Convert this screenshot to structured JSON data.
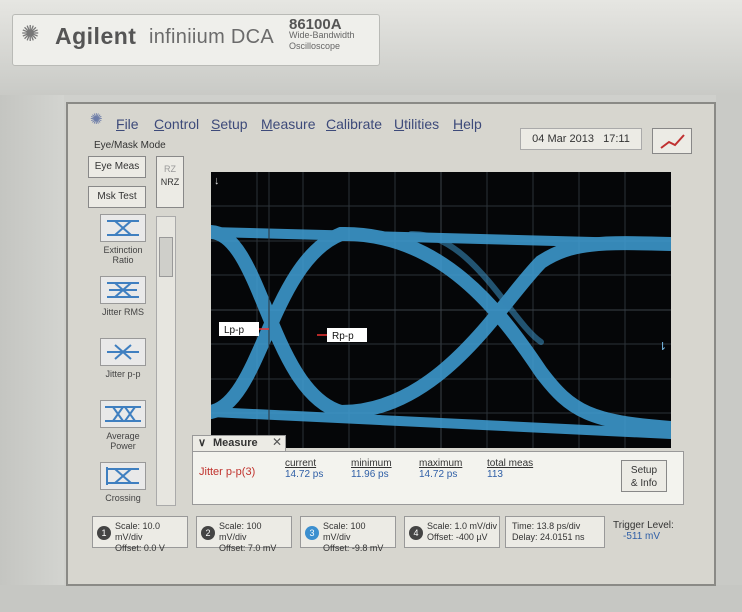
{
  "brand": {
    "company": "Agilent",
    "product": "infiniium DCA",
    "model": "86100A",
    "model_desc_1": "Wide-Bandwidth",
    "model_desc_2": "Oscilloscope"
  },
  "menu": {
    "items": [
      "File",
      "Control",
      "Setup",
      "Measure",
      "Calibrate",
      "Utilities",
      "Help"
    ],
    "date": "04 Mar 2013",
    "time": "17:11"
  },
  "mode": {
    "label": "Eye/Mask Mode",
    "eye_meas": "Eye Meas",
    "msk_test": "Msk Test",
    "rz": "RZ",
    "nrz": "NRZ"
  },
  "tools": [
    {
      "label": "Extinction Ratio",
      "icon": "extinction-ratio-icon"
    },
    {
      "label": "Jitter RMS",
      "icon": "jitter-rms-icon"
    },
    {
      "label": "Jitter p-p",
      "icon": "jitter-pp-icon"
    },
    {
      "label": "Average Power",
      "icon": "average-power-icon"
    },
    {
      "label": "Crossing Percentage",
      "icon": "crossing-percentage-icon"
    }
  ],
  "markers": {
    "left": "Lp-p",
    "right": "Rp-p"
  },
  "measure": {
    "tab_label": "Measure",
    "name": "Jitter p-p(3)",
    "headers": [
      "current",
      "minimum",
      "maximum",
      "total meas"
    ],
    "values": [
      "14.72 ps",
      "11.96 ps",
      "14.72 ps",
      "113"
    ],
    "setup_label_1": "Setup",
    "setup_label_2": "& Info"
  },
  "channels": [
    {
      "num": "1",
      "scale": "Scale: 10.0 mV/div",
      "offset": "Offset: 0.0 V"
    },
    {
      "num": "2",
      "scale": "Scale: 100 mV/div",
      "offset": "Offset: 7.0 mV"
    },
    {
      "num": "3",
      "scale": "Scale: 100 mV/div",
      "offset": "Offset: -9.8 mV"
    },
    {
      "num": "4",
      "scale": "Scale: 1.0 mV/div",
      "offset": "Offset: -400 µV"
    }
  ],
  "timebase": {
    "time": "Time: 13.8 ps/div",
    "delay": "Delay: 24.0151 ns"
  },
  "trigger": {
    "label": "Trigger Level:",
    "value": "-511 mV"
  },
  "colors": {
    "trace": "#3f9fd6",
    "background": "#050608",
    "menu_text": "#3d4a7a"
  }
}
